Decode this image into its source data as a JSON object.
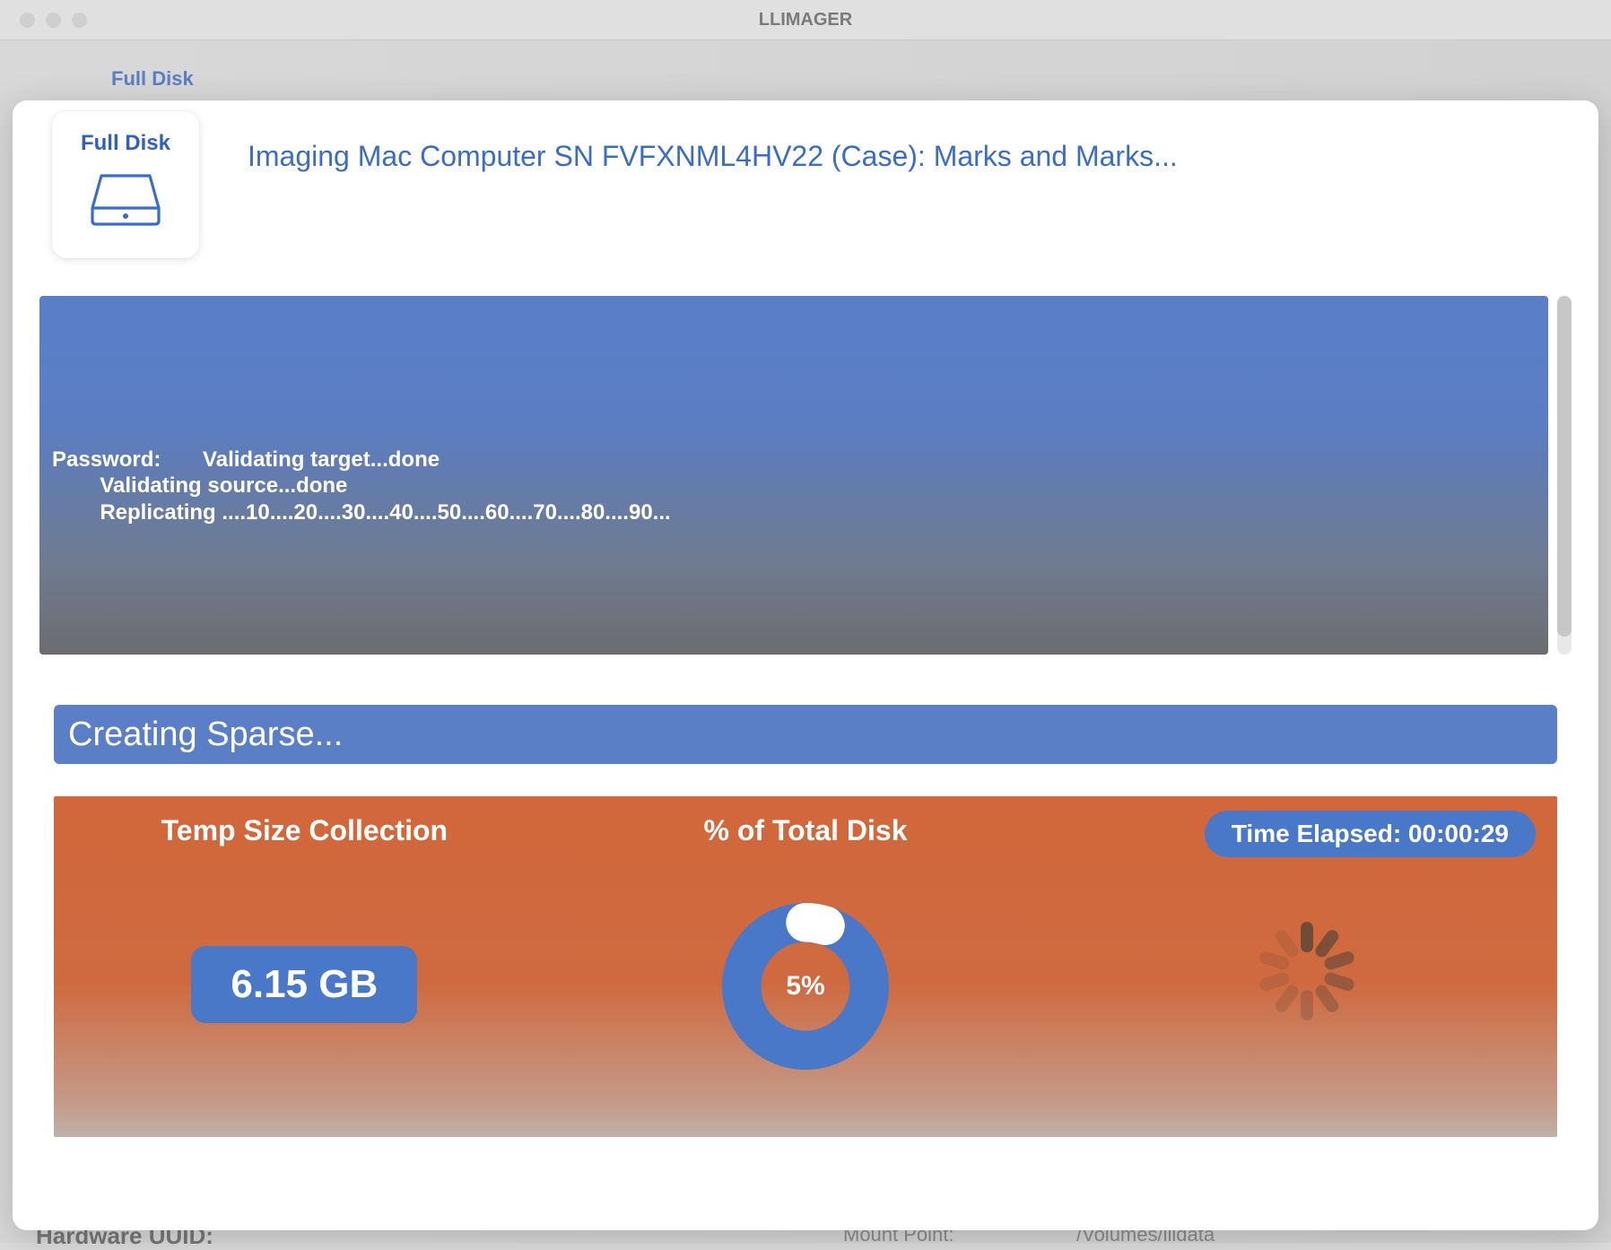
{
  "window": {
    "title": "LLIMAGER"
  },
  "parent": {
    "tab_label": "Full Disk",
    "bottom_left_label": "Hardware UUID:",
    "bottom_mid_label": "Mount Point:",
    "bottom_mid_value": "/Volumes/llidata"
  },
  "sheet": {
    "mode_card_title": "Full Disk",
    "imaging_title": "Imaging Mac Computer SN FVFXNML4HV22 (Case): Marks and Marks..."
  },
  "log": {
    "lines": [
      "Password:       Validating target...done",
      "        Validating source...done",
      "        Replicating ....10....20....30....40....50....60....70....80....90..."
    ]
  },
  "status_banner": "Creating Sparse...",
  "stats": {
    "temp_size_label": "Temp Size Collection",
    "temp_size_value": "6.15 GB",
    "percent_label": "%  of Total Disk",
    "percent_value": 5,
    "percent_text": "5%",
    "time_label_prefix": "Time Elapsed: ",
    "time_value": "00:00:29"
  },
  "spinner": {
    "blades": 10,
    "opacities": [
      0.95,
      0.82,
      0.68,
      0.55,
      0.42,
      0.32,
      0.25,
      0.2,
      0.18,
      0.16
    ]
  }
}
